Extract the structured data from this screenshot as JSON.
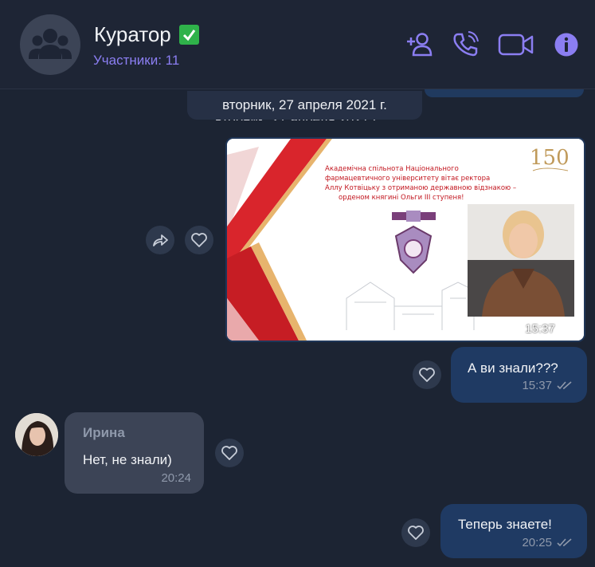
{
  "header": {
    "title": "Куратор",
    "participants": "Участники: 11"
  },
  "chat": {
    "date_label": "вторник, 27 апреля 2021 г.",
    "image_message": {
      "text_line1": "Академічна спільнота Національного",
      "text_line2": "фармацевтичного університету вітає ректора",
      "text_line3": "Аллу Котвіцьку з отриманою державною відзнакою –",
      "text_line4": "орденом княгині Ольги ІІІ ступеня!",
      "badge": "150",
      "time": "15:37"
    },
    "messages": [
      {
        "text": "А ви знали???",
        "time": "15:37"
      },
      {
        "sender": "Ирина",
        "text": "Нет, не знали)",
        "time": "20:24"
      },
      {
        "text": "Теперь знаете!",
        "time": "20:25"
      }
    ]
  }
}
